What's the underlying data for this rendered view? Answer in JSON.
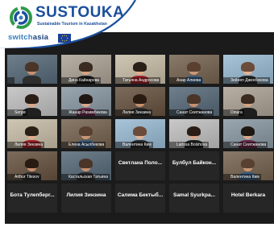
{
  "header": {
    "brand": "SUSTOUKA",
    "tagline": "Sustainable Tourism in Kazakhstan",
    "switch_prefix": "switch",
    "switch_suffix": "asia"
  },
  "participants": [
    {
      "name": "",
      "video": true
    },
    {
      "name": "Дина Кайнарова",
      "video": true
    },
    {
      "name": "Татьяна Андросова",
      "video": true,
      "active": true
    },
    {
      "name": "Анар Алиева",
      "video": true
    },
    {
      "name": "Зейнеп Дженбекова",
      "video": true
    },
    {
      "name": "Sergei",
      "video": true
    },
    {
      "name": "Жанар Рахимбекова",
      "video": true
    },
    {
      "name": "Лилия Зинзина",
      "video": true
    },
    {
      "name": "Санат Сеитжанова",
      "video": true
    },
    {
      "name": "Dinara",
      "video": true
    },
    {
      "name": "Лилия Зинзина",
      "video": true
    },
    {
      "name": "Елена Асылбекова",
      "video": true
    },
    {
      "name": "Валентина Ким",
      "video": true
    },
    {
      "name": "Larissa Bolshova",
      "video": true
    },
    {
      "name": "Санат Сеитжанова",
      "video": true
    },
    {
      "name": "Arthur Tilesov",
      "video": true
    },
    {
      "name": "Кастальская Татьяна",
      "video": true
    },
    {
      "name": "Светлана Поло...",
      "video": false
    },
    {
      "name": "Булбул Байкон...",
      "video": false
    },
    {
      "name": "Валентина Ким",
      "video": true
    },
    {
      "name": "Бота Тулепберг...",
      "video": false
    },
    {
      "name": "Лилия Зинзина",
      "video": false
    },
    {
      "name": "Салима Бектыб...",
      "video": false
    },
    {
      "name": "Samal Syurkpa...",
      "video": false
    },
    {
      "name": "Hotel Berkara",
      "video": false
    }
  ],
  "colors": {
    "brand_blue": "#1a4f9c",
    "active_outline": "#d9d34a",
    "muted_mic": "#e0363a"
  }
}
